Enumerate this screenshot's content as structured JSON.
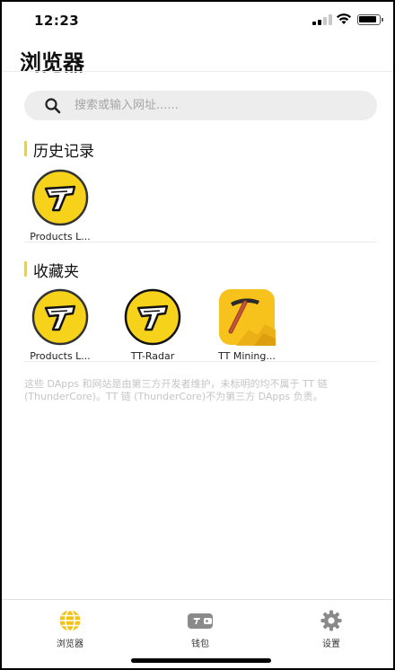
{
  "status_bar": {
    "time": "12:23"
  },
  "header": {
    "title": "浏览器"
  },
  "search": {
    "placeholder": "搜索或输入网址......"
  },
  "history": {
    "title": "历史记录",
    "items": [
      {
        "label": "Products L...",
        "icon": "thundercore-logo"
      }
    ]
  },
  "favorites": {
    "title": "收藏夹",
    "items": [
      {
        "label": "Products L...",
        "icon": "thundercore-logo"
      },
      {
        "label": "TT-Radar",
        "icon": "tt-radar-logo"
      },
      {
        "label": "TT Mining...",
        "icon": "pickaxe-logo"
      }
    ]
  },
  "disclaimer": "这些 DApps 和网站是由第三方开发者维护，未标明的均不属于 TT 链 (ThunderCore)。TT 链 (ThunderCore)不为第三方 DApps 负责。",
  "tab_bar": {
    "browser": "浏览器",
    "wallet": "钱包",
    "settings": "设置"
  },
  "colors": {
    "accent": "#f7d21a",
    "tab_active": "#f2c316",
    "tab_inactive": "#8a8a8a"
  }
}
